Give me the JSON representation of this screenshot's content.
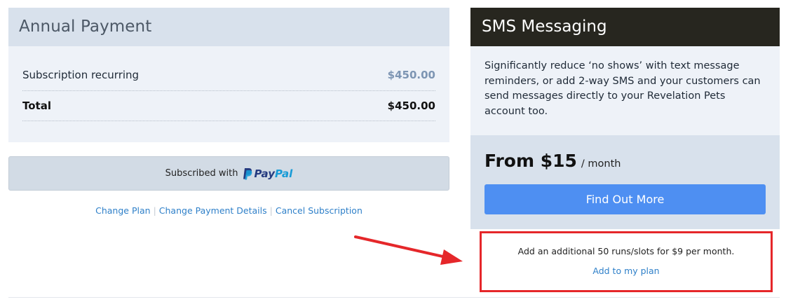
{
  "annual_payment": {
    "title": "Annual Payment",
    "rows": [
      {
        "label": "Subscription recurring",
        "amount": "$450.00"
      },
      {
        "label": "Total",
        "amount": "$450.00"
      }
    ]
  },
  "paypal": {
    "prefix": "Subscribed with",
    "logo_part1": "Pay",
    "logo_part2": "Pal"
  },
  "links": {
    "change_plan": "Change Plan",
    "change_payment": "Change Payment Details",
    "cancel": "Cancel Subscription",
    "separator": "|"
  },
  "sms": {
    "title": "SMS Messaging",
    "description": "Significantly reduce ‘no shows’ with text message reminders, or add 2-way SMS and your customers can send messages directly to your Revelation Pets account too.",
    "price": "From $15",
    "price_unit": "/ month",
    "cta": "Find Out More"
  },
  "addon": {
    "text": "Add an additional 50 runs/slots for $9 per month.",
    "link": "Add to my plan"
  },
  "colors": {
    "annotation_red": "#e5272a",
    "button_blue": "#4e8ff2",
    "link_blue": "#2f80c9"
  },
  "icons": {
    "paypal_logo": "paypal-logo-icon",
    "annotation_arrow": "arrow-right-icon"
  }
}
